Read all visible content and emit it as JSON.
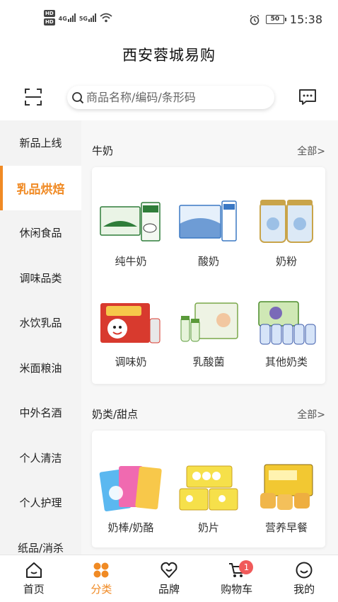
{
  "status_bar": {
    "hd1": "HD",
    "hd2": "HD",
    "net1": "4G",
    "net2": "5G",
    "battery": "50",
    "time": "15:38"
  },
  "header": {
    "title": "西安蓉城易购",
    "search_placeholder": "商品名称/编码/条形码"
  },
  "sidebar": {
    "items": [
      {
        "label": "新品上线"
      },
      {
        "label": "乳品烘焙"
      },
      {
        "label": "休闲食品"
      },
      {
        "label": "调味品类"
      },
      {
        "label": "水饮乳品"
      },
      {
        "label": "米面粮油"
      },
      {
        "label": "中外名酒"
      },
      {
        "label": "个人清洁"
      },
      {
        "label": "个人护理"
      },
      {
        "label": "纸品/消杀"
      }
    ],
    "active_index": 1
  },
  "sections": [
    {
      "title": "牛奶",
      "all_label": "全部>",
      "products": [
        {
          "name": "纯牛奶"
        },
        {
          "name": "酸奶"
        },
        {
          "name": "奶粉"
        },
        {
          "name": "调味奶"
        },
        {
          "name": "乳酸菌"
        },
        {
          "name": "其他奶类"
        }
      ]
    },
    {
      "title": "奶类/甜点",
      "all_label": "全部>",
      "products": [
        {
          "name": "奶棒/奶酪"
        },
        {
          "name": "奶片"
        },
        {
          "name": "营养早餐"
        }
      ]
    }
  ],
  "tabbar": {
    "tabs": [
      {
        "label": "首页"
      },
      {
        "label": "分类"
      },
      {
        "label": "品牌"
      },
      {
        "label": "购物车",
        "badge": "1"
      },
      {
        "label": "我的"
      }
    ],
    "active_index": 1
  },
  "colors": {
    "accent": "#f08a24",
    "badge": "#f05a5a",
    "sidebar_bg": "#f3f3f3"
  }
}
